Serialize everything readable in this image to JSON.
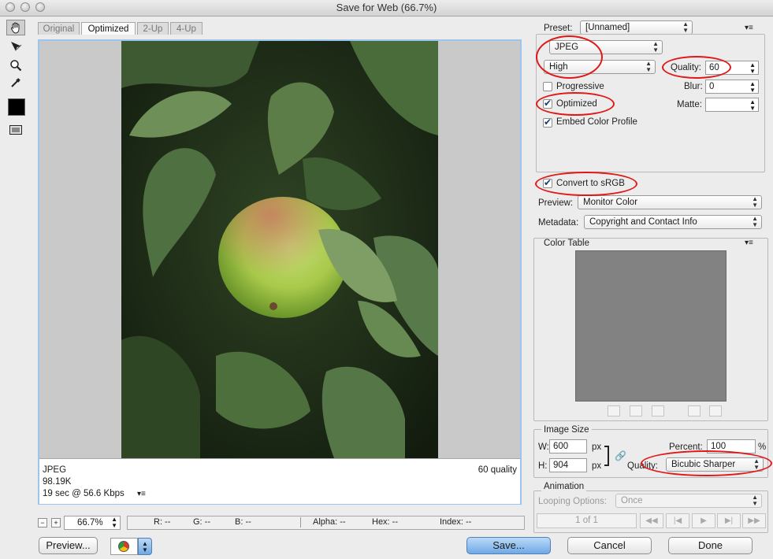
{
  "window": {
    "title": "Save for Web (66.7%)"
  },
  "tabs": [
    "Original",
    "Optimized",
    "2-Up",
    "4-Up"
  ],
  "info": {
    "format": "JPEG",
    "size": "98.19K",
    "time": "19 sec @ 56.6 Kbps",
    "quality": "60 quality"
  },
  "status": {
    "zoom": "66.7%",
    "r": "R: --",
    "g": "G: --",
    "b": "B: --",
    "alpha": "Alpha: --",
    "hex": "Hex: --",
    "index": "Index: --"
  },
  "buttons": {
    "preview": "Preview...",
    "save": "Save...",
    "cancel": "Cancel",
    "done": "Done"
  },
  "settings": {
    "preset_label": "Preset:",
    "preset_value": "[Unnamed]",
    "format": "JPEG",
    "compression": "High",
    "quality_label": "Quality:",
    "quality_value": "60",
    "progressive": "Progressive",
    "blur_label": "Blur:",
    "blur_value": "0",
    "optimized": "Optimized",
    "matte_label": "Matte:",
    "embed_profile": "Embed Color Profile",
    "convert_srgb": "Convert to sRGB",
    "preview_label": "Preview:",
    "preview_value": "Monitor Color",
    "metadata_label": "Metadata:",
    "metadata_value": "Copyright and Contact Info"
  },
  "checks": {
    "progressive": false,
    "optimized": true,
    "embed_profile": true,
    "convert_srgb": true
  },
  "color_table": {
    "title": "Color Table"
  },
  "image_size": {
    "title": "Image Size",
    "w_label": "W:",
    "w_value": "600",
    "h_label": "H:",
    "h_value": "904",
    "px": "px",
    "percent_label": "Percent:",
    "percent_value": "100",
    "pct": "%",
    "quality_label": "Quality:",
    "quality_value": "Bicubic Sharper"
  },
  "animation": {
    "title": "Animation",
    "looping_label": "Looping Options:",
    "looping_value": "Once",
    "frame": "1 of 1"
  },
  "colors": {
    "highlight": "#e01818",
    "accent": "#9dc4ea",
    "primary_button": "#6fa9e6"
  }
}
